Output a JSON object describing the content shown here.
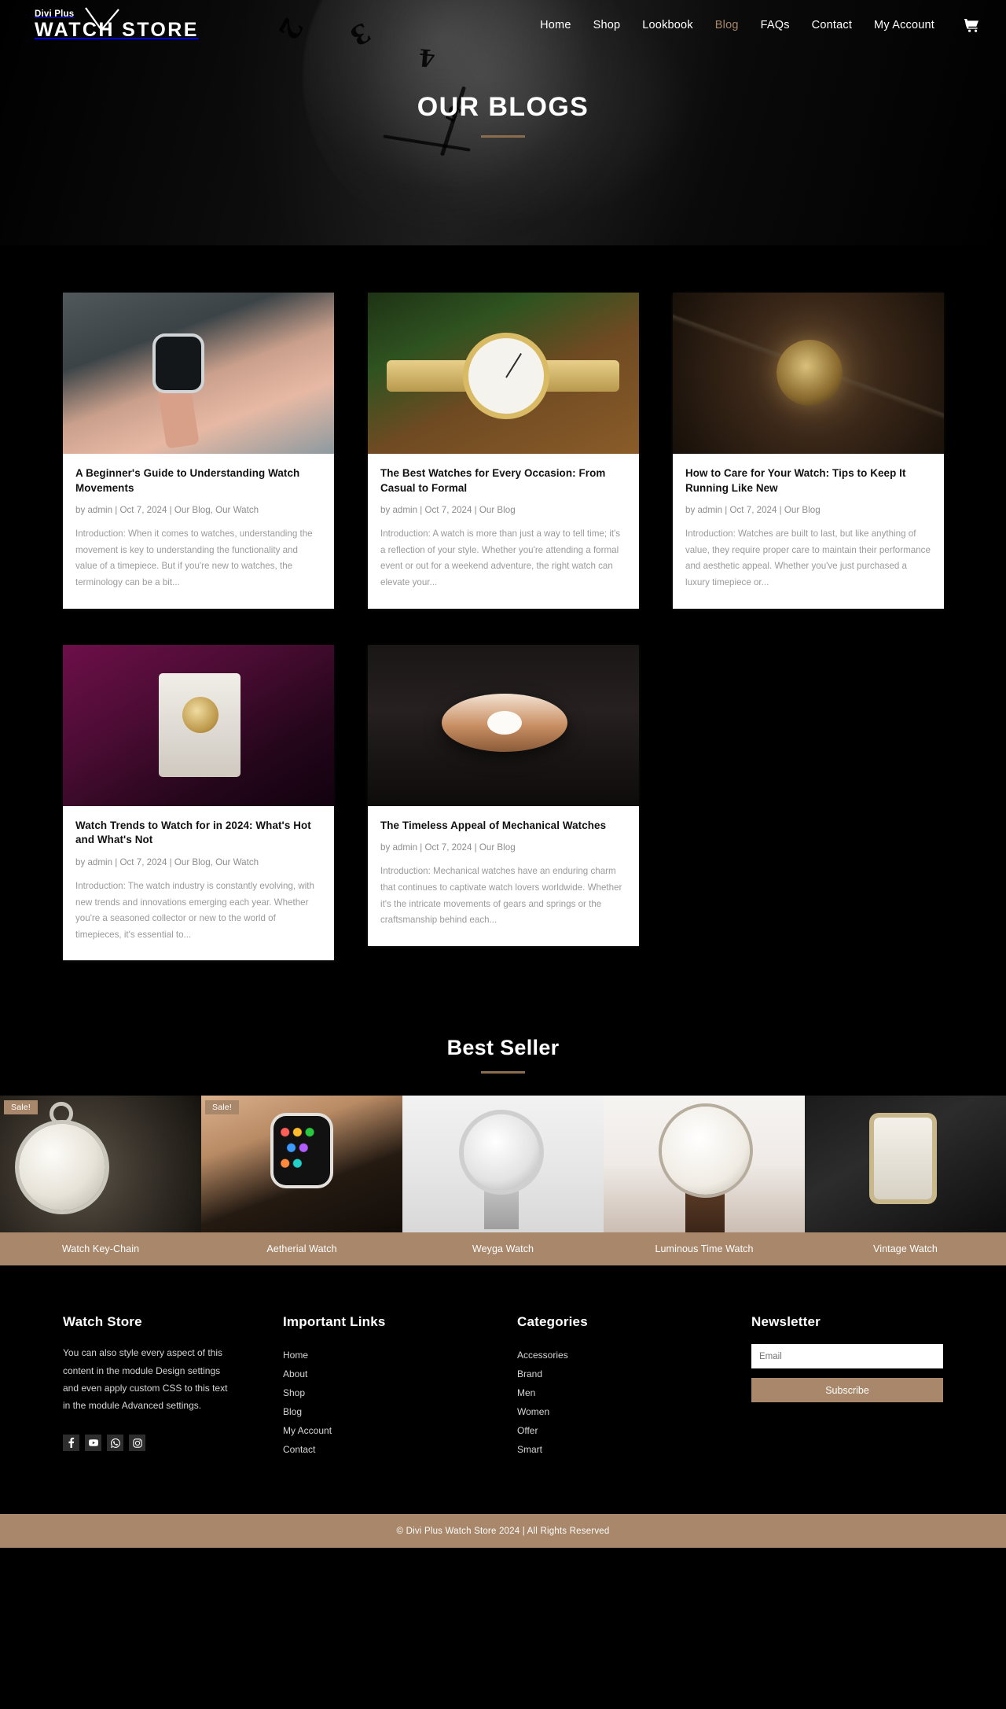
{
  "brand": {
    "logo_sub": "Divi Plus",
    "logo_main": "WATCH STORE",
    "accent": "#a8876a"
  },
  "nav": {
    "items": [
      {
        "label": "Home",
        "active": false
      },
      {
        "label": "Shop",
        "active": false
      },
      {
        "label": "Lookbook",
        "active": false
      },
      {
        "label": "Blog",
        "active": true
      },
      {
        "label": "FAQs",
        "active": false
      },
      {
        "label": "Contact",
        "active": false
      },
      {
        "label": "My Account",
        "active": false
      }
    ],
    "cart_icon": "shopping-cart-icon"
  },
  "hero": {
    "title": "OUR BLOGS"
  },
  "blog": {
    "posts": [
      {
        "title": "A Beginner's Guide to Understanding Watch Movements",
        "meta": "by admin | Oct 7, 2024 | Our Blog, Our Watch",
        "excerpt": "Introduction: When it comes to watches, understanding the movement is key to understanding the functionality and value of a timepiece. But if you're new to watches, the terminology can be a bit..."
      },
      {
        "title": "The Best Watches for Every Occasion: From Casual to Formal",
        "meta": "by admin | Oct 7, 2024 | Our Blog",
        "excerpt": "Introduction: A watch is more than just a way to tell time; it's a reflection of your style. Whether you're attending a formal event or out for a weekend adventure, the right watch can elevate your..."
      },
      {
        "title": "How to Care for Your Watch: Tips to Keep It Running Like New",
        "meta": "by admin | Oct 7, 2024 | Our Blog",
        "excerpt": "Introduction: Watches are built to last, but like anything of value, they require proper care to maintain their performance and aesthetic appeal. Whether you've just purchased a luxury timepiece or..."
      },
      {
        "title": "Watch Trends to Watch for in 2024: What's Hot and What's Not",
        "meta": "by admin | Oct 7, 2024 | Our Blog, Our Watch",
        "excerpt": "Introduction: The watch industry is constantly evolving, with new trends and innovations emerging each year. Whether you're a seasoned collector or new to the world of timepieces, it's essential to..."
      },
      {
        "title": "The Timeless Appeal of Mechanical Watches",
        "meta": "by admin | Oct 7, 2024 | Our Blog",
        "excerpt": "Introduction: Mechanical watches have an enduring charm that continues to captivate watch lovers worldwide. Whether it's the intricate movements of gears and springs or the craftsmanship behind each..."
      }
    ]
  },
  "best_seller": {
    "title": "Best Seller",
    "sale_label": "Sale!",
    "products": [
      {
        "name": "Watch Key-Chain",
        "on_sale": true
      },
      {
        "name": "Aetherial Watch",
        "on_sale": true
      },
      {
        "name": "Weyga Watch",
        "on_sale": false
      },
      {
        "name": "Luminous Time Watch",
        "on_sale": false
      },
      {
        "name": "Vintage Watch",
        "on_sale": false
      }
    ]
  },
  "footer": {
    "about": {
      "heading": "Watch Store",
      "text": "You can also style every aspect of this content in the module Design settings and even apply custom CSS to this text in the module Advanced settings.",
      "socials": [
        "facebook-icon",
        "youtube-icon",
        "whatsapp-icon",
        "instagram-icon"
      ]
    },
    "important_links": {
      "heading": "Important Links",
      "items": [
        "Home",
        "About",
        "Shop",
        "Blog",
        "My Account",
        "Contact"
      ]
    },
    "categories": {
      "heading": "Categories",
      "items": [
        "Accessories",
        "Brand",
        "Men",
        "Women",
        "Offer",
        "Smart"
      ]
    },
    "newsletter": {
      "heading": "Newsletter",
      "email_placeholder": "Email",
      "email_value": "",
      "subscribe_label": "Subscribe"
    },
    "copyright": "© Divi Plus Watch Store 2024 | All Rights Reserved"
  }
}
